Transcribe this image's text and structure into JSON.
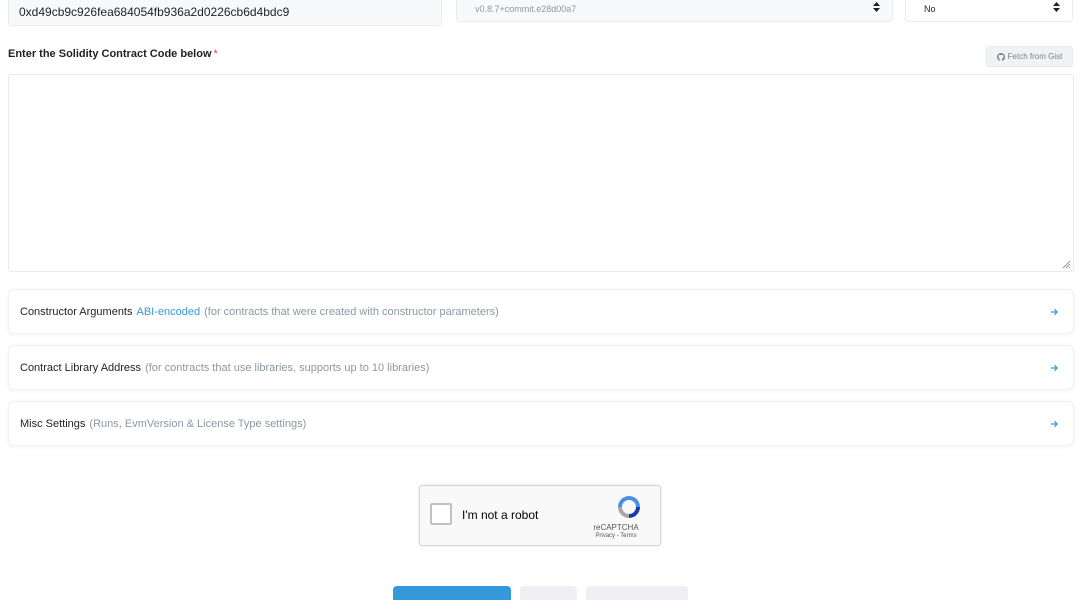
{
  "form": {
    "contract_address": "0xd49cb9c926fea684054fb936a2d0226cb6d4bdc9",
    "compiler_version": "v0.8.7+commit.e28d00a7",
    "optimization": "No"
  },
  "code_section": {
    "label": "Enter the Solidity Contract Code below",
    "required_mark": "*",
    "fetch_gist_label": "Fetch from Gist",
    "code_value": ""
  },
  "accordions": [
    {
      "title": "Constructor Arguments",
      "link": "ABI-encoded",
      "hint": "(for contracts that were created with constructor parameters)"
    },
    {
      "title": "Contract Library Address",
      "link": "",
      "hint": "(for contracts that use libraries, supports up to 10 libraries)"
    },
    {
      "title": "Misc Settings",
      "link": "",
      "hint": "(Runs, EvmVersion & License Type settings)"
    }
  ],
  "recaptcha": {
    "label": "I'm not a robot",
    "brand": "reCAPTCHA",
    "terms": "Privacy - Terms"
  },
  "colors": {
    "primary": "#3498db",
    "required": "#de4437",
    "muted_text": "#8c98a4"
  }
}
